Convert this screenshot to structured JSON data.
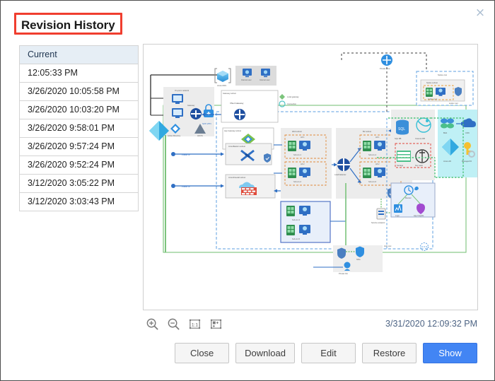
{
  "dialog": {
    "title": "Revision History",
    "close_label": "×",
    "annotation_color": "#f03e2f"
  },
  "revision_list": {
    "header_label": "Current",
    "items": [
      {
        "label": "12:05:33 PM"
      },
      {
        "label": "3/26/2020 10:05:58 PM"
      },
      {
        "label": "3/26/2020 10:03:20 PM"
      },
      {
        "label": "3/26/2020 9:58:01 PM"
      },
      {
        "label": "3/26/2020 9:57:24 PM"
      },
      {
        "label": "3/26/2020 9:52:24 PM"
      },
      {
        "label": "3/12/2020 3:05:22 PM"
      },
      {
        "label": "3/12/2020 3:03:43 PM"
      }
    ]
  },
  "preview": {
    "timestamp": "3/31/2020 12:09:32 PM",
    "zoom_tools": [
      {
        "name": "zoom-in-icon",
        "label": "Zoom In"
      },
      {
        "name": "zoom-out-icon",
        "label": "Zoom Out"
      },
      {
        "name": "actual-size-icon",
        "label": "1:1"
      },
      {
        "name": "fit-page-icon",
        "label": "Fit Page"
      }
    ],
    "diagram": {
      "kind": "azure-reference-architecture",
      "labels": {
        "azure_dns": "Azure DNS",
        "users_left": "Internet user",
        "users_right": "Internet user",
        "on_prem_network": "On-prem network",
        "on_prem_gateway": "Gateway",
        "on_prem_ad": "Active Directory",
        "on_prem_adfs": "AD FS",
        "site_vpn": "S2S VPN",
        "gateway_subnet": "Gateway subnet",
        "vnet_gateway": "VNet Gateway",
        "local_gateway": "Local gateway",
        "connection": "Connection",
        "appgw_subnet": "App Gateway subnet",
        "appgw": "App Gateway",
        "public_ip_1": "Public IP",
        "public_ip_2": "Public IP",
        "azurebastion_subnet": "AzureBastion subnet",
        "bastion": "Bastion",
        "azurefirewall_subnet": "AzureFirewall subnet",
        "firewall": "Firewall",
        "mgmt_subnet": "Mgmt subnet",
        "web_subnet": "Web subnet",
        "biz_subnet": "Biz subnet",
        "data_subnet": "Data subnet",
        "hub_vnet": "Hub vnet",
        "spoke_vnet": "Spoke vnet",
        "spoke_subnet": "Spoke subnet",
        "private_zone": "Private zone",
        "vnet_peering": "VNet peering",
        "private_link": "Private link",
        "load_balancer": "Load balancer",
        "vm_1": "hub-vm-1",
        "vm_2": "hub-vm-2",
        "vm_3": "hub-vm-3",
        "vm_4": "hub-vm-4",
        "vm_5": "hub-vm-5",
        "vm_6": "hub-vm-6",
        "spoke_vm": "spoke-vm-1",
        "az1": "AZ 1",
        "az2": "AZ 2",
        "sql_db": "SQL DB",
        "cosmos_db": "Cosmos DB",
        "storage": "Storage",
        "key_vault": "Key vault",
        "blob": "Blob",
        "cdn": "CDN",
        "azure_ad": "Azure AD",
        "managed_id": "Managed ID",
        "monitor": "Monitor",
        "logs": "Logs",
        "app_insights": "App Insights",
        "nsg": "NSG",
        "service_endpoint": "Service endpoint"
      }
    }
  },
  "footer": {
    "buttons": [
      {
        "label": "Close",
        "primary": false
      },
      {
        "label": "Download",
        "primary": false
      },
      {
        "label": "Edit",
        "primary": false
      },
      {
        "label": "Restore",
        "primary": false
      },
      {
        "label": "Show",
        "primary": true
      }
    ]
  }
}
